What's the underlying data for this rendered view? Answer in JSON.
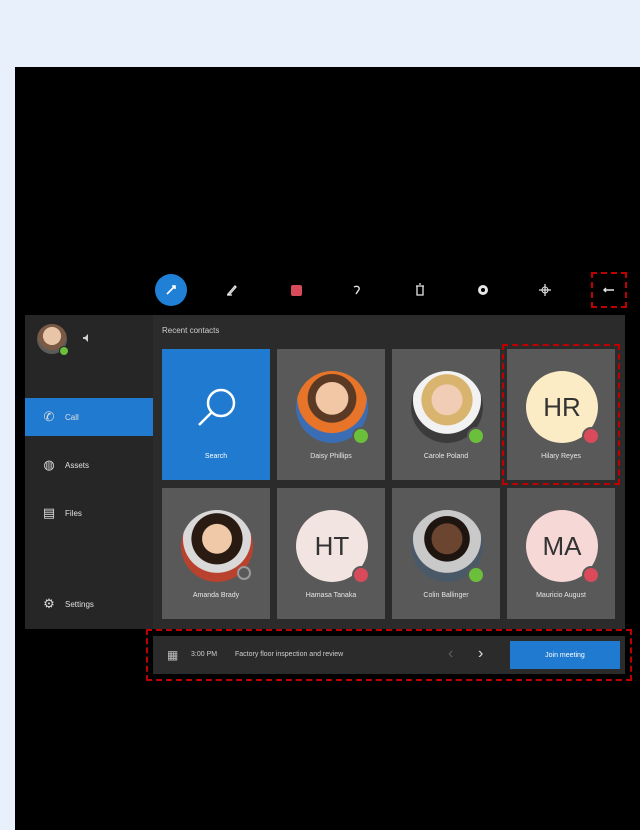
{
  "toolbar": {
    "icons": [
      "pin-icon",
      "pen-icon",
      "stop-record-icon",
      "undo-icon",
      "delete-icon",
      "settings-icon",
      "move-icon",
      "more-icon"
    ]
  },
  "sidebar": {
    "self_status": "🔇",
    "items": [
      {
        "label": "Call",
        "icon": "phone-icon",
        "selected": true
      },
      {
        "label": "Assets",
        "icon": "assets-icon"
      },
      {
        "label": "Files",
        "icon": "files-icon"
      },
      {
        "label": "Settings",
        "icon": "settings-icon"
      }
    ]
  },
  "main": {
    "recent_label": "Recent contacts",
    "contacts": [
      {
        "name": "Search"
      },
      {
        "name": "Daisy Phillips",
        "status": "available"
      },
      {
        "name": "Carole Poland",
        "status": "available"
      },
      {
        "name": "Hilary Reyes",
        "initials": "HR",
        "status": "busy"
      },
      {
        "name": "Amanda Brady",
        "status": "away"
      },
      {
        "name": "Hamasa Tanaka",
        "initials": "HT",
        "status": "busy"
      },
      {
        "name": "Colin Ballinger",
        "status": "available"
      },
      {
        "name": "Mauricio August",
        "initials": "MA",
        "status": "busy"
      }
    ]
  },
  "meeting": {
    "time": "3:00 PM",
    "title": "Factory floor inspection and review",
    "join_label": "Join meeting"
  },
  "colors": {
    "accent": "#1f7ad0",
    "available": "#6bbf3a",
    "busy": "#d94a5a",
    "highlight": "#c00000"
  }
}
